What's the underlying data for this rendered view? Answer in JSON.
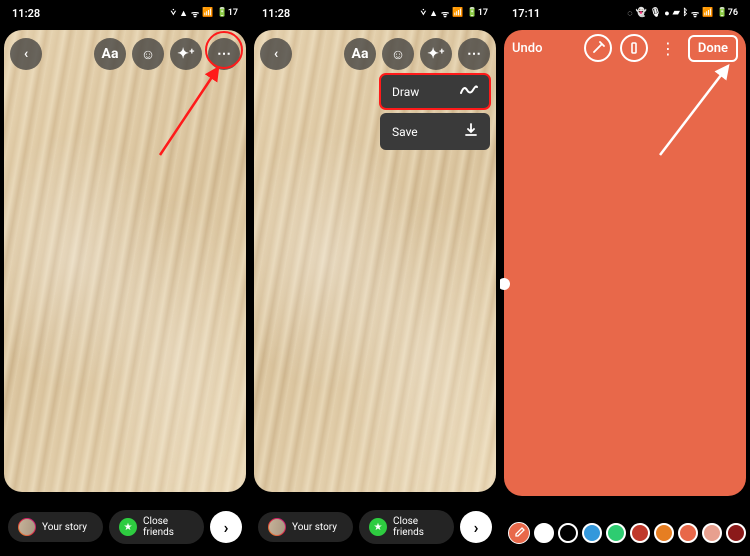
{
  "panel1": {
    "time": "11:28",
    "battery": "17",
    "icons": {
      "back": "‹",
      "text": "Aa",
      "sticker": "☺",
      "sparkle": "✦⁺",
      "more": "⋯"
    },
    "bottom": {
      "your_story": "Your story",
      "close_friends": "Close friends",
      "send": "›"
    }
  },
  "panel2": {
    "time": "11:28",
    "battery": "17",
    "menu": {
      "draw": "Draw",
      "save": "Save"
    },
    "bottom": {
      "your_story": "Your story",
      "close_friends": "Close friends",
      "send": "›"
    }
  },
  "panel3": {
    "time": "17:11",
    "battery": "76",
    "undo": "Undo",
    "done": "Done",
    "canvas_color": "#e8684a",
    "palette": [
      "#ffffff",
      "#000000",
      "#3498db",
      "#2ecc71",
      "#c0392b",
      "#e67e22",
      "#e8684a",
      "#e8a08f",
      "#8b1a1a",
      "#3cbce8",
      "#4fc3f7"
    ]
  }
}
